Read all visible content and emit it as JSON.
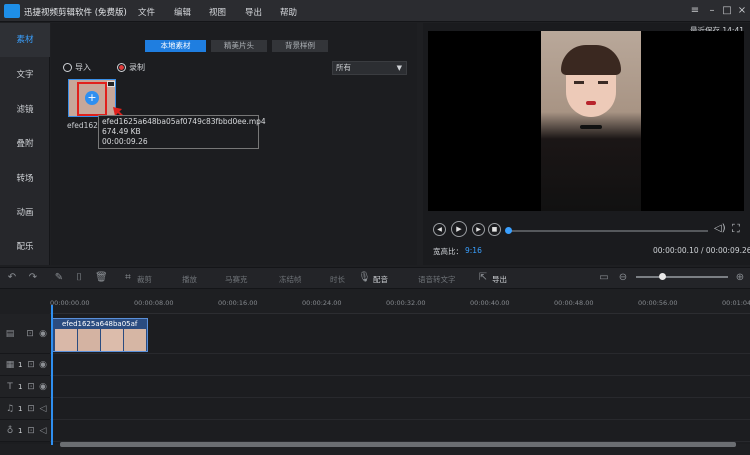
{
  "app": {
    "title": "迅捷视频剪辑软件 (免费版)"
  },
  "menu": [
    "文件",
    "编辑",
    "视图",
    "导出",
    "帮助"
  ],
  "nav": [
    "素材",
    "文字",
    "滤镜",
    "叠附",
    "转场",
    "动画",
    "配乐"
  ],
  "tabs": [
    "本地素材",
    "精美片头",
    "背景样例"
  ],
  "media": {
    "import_label": "导入",
    "record_label": "录制",
    "filter_value": "所有",
    "thumb_name": "efed1625",
    "tooltip_name": "efed1625a648ba05af0749c83fbbd0ee.mp4",
    "tooltip_size": "674.49 KB",
    "tooltip_duration": "00:00:09.26"
  },
  "preview": {
    "save_status": "最近保存 14:41",
    "ratio_label": "宽高比：",
    "ratio_value": "9:16",
    "timecode": "00:00:00.10 / 00:00:09.26"
  },
  "toolbar": [
    "裁剪",
    "播放",
    "马赛克",
    "冻结帧",
    "时长",
    "配音",
    "语音转文字",
    "导出"
  ],
  "ruler": [
    "00:00:00.00",
    "00:00:08.00",
    "00:00:16.00",
    "00:00:24.00",
    "00:00:32.00",
    "00:00:40.00",
    "00:00:48.00",
    "00:00:56.00",
    "00:01:04"
  ],
  "clip": {
    "label": "efed1625a648ba05af"
  },
  "track_nums": [
    "1",
    "1",
    "1",
    "1"
  ]
}
